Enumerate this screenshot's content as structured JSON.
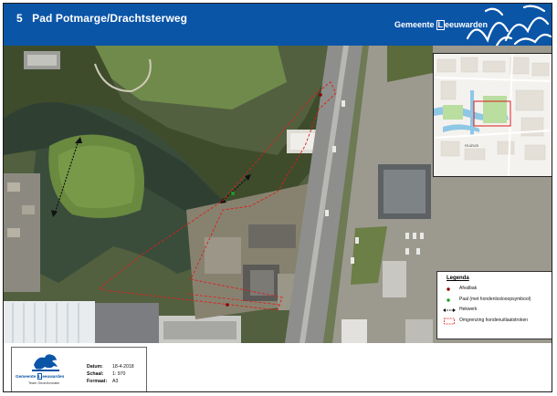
{
  "header": {
    "number": "5",
    "title": "Pad Potmarge/Drachtsterweg",
    "brand_prefix": "Gemeente",
    "brand_l": "L",
    "brand_rest": "eeuwarden",
    "background_color": "#0b55a7"
  },
  "map": {
    "boundary_color": "#e01b1b",
    "waste_bin_color": "#8b0000",
    "post_color": "#1a9e2a"
  },
  "inset": {
    "place_label": "Huizum",
    "extent_color": "#d7191c"
  },
  "legend": {
    "title": "Legenda",
    "items": [
      {
        "label": "Afvalbak",
        "symbol": "dark-red-dot-icon"
      },
      {
        "label": "Paal (met hondenloslooopsymbool)",
        "symbol": "green-dot-icon"
      },
      {
        "label": "Hekwerk",
        "symbol": "fence-arrow-icon"
      },
      {
        "label": "Omgrenzing hondenuitlaatstroken",
        "symbol": "dashed-red-box-icon"
      }
    ]
  },
  "titleblock": {
    "org_prefix": "Gemeente",
    "org_l": "L",
    "org_rest": "eeuwarden",
    "team": "Team Geoinformatie",
    "date_label": "Datum:",
    "date_value": "18-4-2018",
    "scale_label": "Schaal:",
    "scale_value": "1: 970",
    "format_label": "Formaat:",
    "format_value": "A3"
  }
}
